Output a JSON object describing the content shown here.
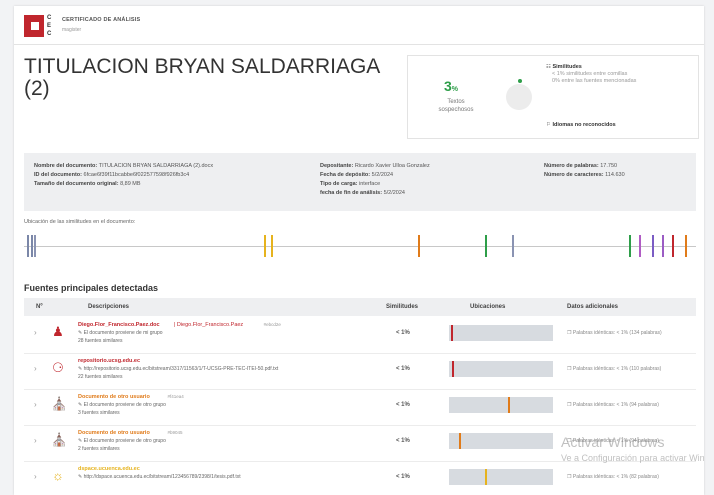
{
  "header": {
    "logo_letters": [
      "C",
      "E",
      "C"
    ],
    "title": "CERTIFICADO DE ANÁLISIS",
    "subtitle": "magister"
  },
  "document_title": "TITULACION BRYAN SALDARRIAGA (2)",
  "stats": {
    "percent": "3",
    "percent_unit": "%",
    "percent_label": "Textos sospechosos",
    "similarities": "Similitudes",
    "similarities_sub1": "< 1% similitudes entre comillas",
    "similarities_sub2": "0% entre las fuentes mencionadas",
    "unrecognized": "Idiomas no reconocidos"
  },
  "meta": {
    "col1": [
      {
        "label": "Nombre del documento:",
        "value": "TITULACION BRYAN SALDARRIAGA (2).docx"
      },
      {
        "label": "ID del documento:",
        "value": "6fcae6f39f11bcabbe6f022577598f926fb3c4"
      },
      {
        "label": "Tamaño del documento original:",
        "value": "8,89 MB"
      }
    ],
    "col2": [
      {
        "label": "Depositante:",
        "value": "Ricardo Xavier Ulloa Gonzalez"
      },
      {
        "label": "Fecha de depósito:",
        "value": "5/2/2024"
      },
      {
        "label": "Tipo de carga:",
        "value": "interface"
      },
      {
        "label": "fecha de fin de análisis:",
        "value": "5/2/2024"
      }
    ],
    "col3": [
      {
        "label": "Número de palabras:",
        "value": "17.750"
      },
      {
        "label": "Número de caracteres:",
        "value": "114.630"
      }
    ]
  },
  "distribution_label": "Ubicación de las similitudes en el documento:",
  "section_title": "Fuentes principales detectadas",
  "table": {
    "headers": [
      "Nº",
      "Descripciones",
      "Similitudes",
      "Ubicaciones",
      "Datos adicionales"
    ],
    "rows": [
      {
        "num": "1",
        "icon": "users-icon",
        "title": "Diego.Flor_Francisco.Paez.doc",
        "extra": "| Diego.Flor_Francisco.Paez",
        "extra_tag": "#ebcd2e",
        "desc": "El documento proviene de mi grupo",
        "count": "28 fuentes similares",
        "sim": "< 1%",
        "color": "#c0262d",
        "loc": 0.02,
        "add": "Palabras idénticas: < 1% (134 palabras)"
      },
      {
        "num": "2",
        "icon": "globe-icon",
        "title": "repositorio.ucsg.edu.ec",
        "extra": "",
        "extra_tag": "",
        "desc": "http://repositorio.ucsg.edu.ec/bitstream/3317/11563/1/T-UCSG-PRE-TEC-ITEI-50.pdf.txt",
        "count": "22 fuentes similares",
        "sim": "< 1%",
        "color": "#c0262d",
        "loc": 0.03,
        "add": "Palabras idénticas: < 1% (110 palabras)"
      },
      {
        "num": "3",
        "icon": "institution-icon",
        "title": "Documento de otro usuario",
        "extra": "",
        "extra_tag": "#f41ea4",
        "desc": "El documento proviene de otro grupo",
        "count": "3 fuentes similares",
        "sim": "< 1%",
        "color": "#e07b1a",
        "loc": 0.58,
        "add": "Palabras idénticas: < 1% (94 palabras)"
      },
      {
        "num": "4",
        "icon": "institution-icon",
        "title": "Documento de otro usuario",
        "extra": "",
        "extra_tag": "#b9045",
        "desc": "El documento proviene de otro grupo",
        "count": "2 fuentes similares",
        "sim": "< 1%",
        "color": "#e07b1a",
        "loc": 0.1,
        "add": "Palabras idénticas: < 1% (94 palabras)"
      },
      {
        "num": "5",
        "icon": "lightbulb-icon",
        "title": "dspace.ucuenca.edu.ec",
        "extra": "",
        "extra_tag": "",
        "desc": "http://dspace.ucuenca.edu.ec/bitstream/123456789/2398/1/tesis.pdf.txt",
        "count": "",
        "sim": "< 1%",
        "color": "#e6b31e",
        "loc": 0.35,
        "add": "Palabras idénticas: < 1% (82 palabras)"
      }
    ]
  },
  "distribution_marks": [
    {
      "pos": 0.005,
      "color": "#7b87a8"
    },
    {
      "pos": 0.01,
      "color": "#7b87a8"
    },
    {
      "pos": 0.015,
      "color": "#8a93b2"
    },
    {
      "pos": 0.36,
      "color": "#e6b31e"
    },
    {
      "pos": 0.37,
      "color": "#e6b31e"
    },
    {
      "pos": 0.59,
      "color": "#e07b1a"
    },
    {
      "pos": 0.69,
      "color": "#2e9e49"
    },
    {
      "pos": 0.73,
      "color": "#8a93b2"
    },
    {
      "pos": 0.905,
      "color": "#2e9e49"
    },
    {
      "pos": 0.92,
      "color": "#b05cc4"
    },
    {
      "pos": 0.94,
      "color": "#7b5cc4"
    },
    {
      "pos": 0.955,
      "color": "#9b5cc4"
    },
    {
      "pos": 0.97,
      "color": "#c0262d"
    },
    {
      "pos": 0.99,
      "color": "#e07b1a"
    }
  ],
  "watermark": {
    "line1": "Activar Windows",
    "line2": "Ve a Configuración para activar Windows."
  }
}
